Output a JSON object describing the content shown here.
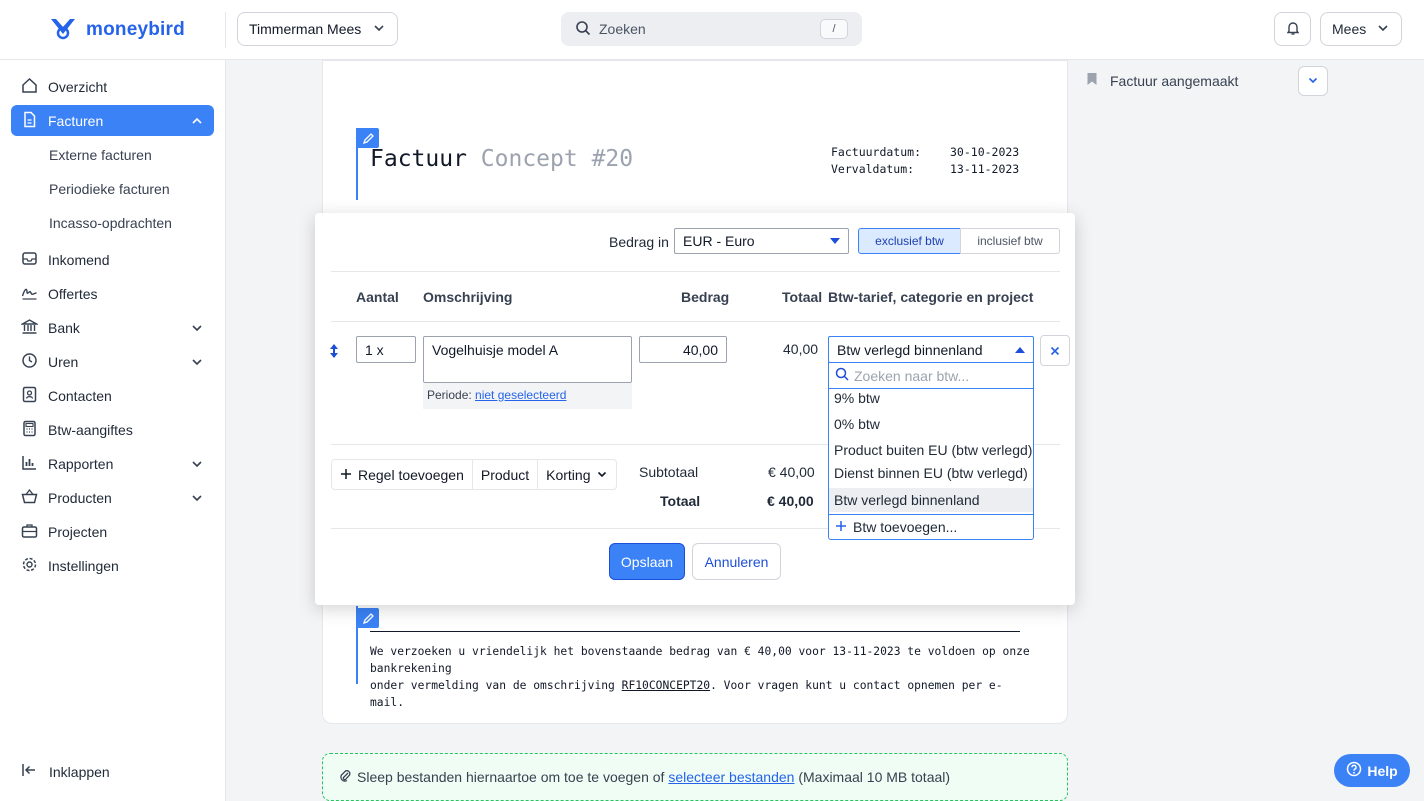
{
  "header": {
    "logo_text": "moneybird",
    "company": "Timmerman Mees",
    "search_placeholder": "Zoeken",
    "search_shortcut": "/",
    "user": "Mees"
  },
  "sidebar": {
    "items": [
      {
        "label": "Overzicht"
      },
      {
        "label": "Facturen"
      },
      {
        "label": "Externe facturen"
      },
      {
        "label": "Periodieke facturen"
      },
      {
        "label": "Incasso-opdrachten"
      },
      {
        "label": "Inkomend"
      },
      {
        "label": "Offertes"
      },
      {
        "label": "Bank"
      },
      {
        "label": "Uren"
      },
      {
        "label": "Contacten"
      },
      {
        "label": "Btw-aangiftes"
      },
      {
        "label": "Rapporten"
      },
      {
        "label": "Producten"
      },
      {
        "label": "Projecten"
      },
      {
        "label": "Instellingen"
      }
    ],
    "collapse_label": "Inklappen"
  },
  "invoice": {
    "title": "Factuur",
    "concept": "Concept #20",
    "date_label": "Factuurdatum:",
    "date_value": "30-10-2023",
    "due_label": "Vervaldatum:",
    "due_value": "13-11-2023",
    "footer_1": "We verzoeken u vriendelijk het bovenstaande bedrag van € 40,00 voor 13-11-2023 te voldoen op onze bankrekening",
    "footer_2a": "onder vermelding van de omschrijving ",
    "footer_2_ref": "RF10CONCEPT20",
    "footer_2b": ". Voor vragen kunt u contact opnemen per e-mail."
  },
  "editor": {
    "amount_in_label": "Bedrag in",
    "currency": "EUR - Euro",
    "excl_label": "exclusief btw",
    "incl_label": "inclusief btw",
    "col_qty": "Aantal",
    "col_desc": "Omschrijving",
    "col_amount": "Bedrag",
    "col_total": "Totaal",
    "col_vat": "Btw-tarief, categorie en project",
    "row": {
      "qty": "1 x",
      "description": "Vogelhuisje model A",
      "amount": "40,00",
      "total": "40,00",
      "vat": "Btw verlegd binnenland",
      "period_label": "Periode:",
      "period_link": "niet geselecteerd"
    },
    "add_line": "Regel toevoegen",
    "product": "Product",
    "discount": "Korting",
    "subtotal_label": "Subtotaal",
    "subtotal_value": "€ 40,00",
    "total_label": "Totaal",
    "total_value": "€ 40,00",
    "save": "Opslaan",
    "cancel": "Annuleren"
  },
  "vat_dropdown": {
    "search_placeholder": "Zoeken naar btw...",
    "options": [
      "9% btw",
      "0% btw",
      "Product buiten EU (btw verlegd)",
      "Dienst binnen EU (btw verlegd)",
      "Btw verlegd binnenland"
    ],
    "selected": "Btw verlegd binnenland",
    "add_label": "Btw toevoegen..."
  },
  "attachments": {
    "text_before": "Sleep bestanden hiernaartoe om toe te voegen of ",
    "link": "selecteer bestanden",
    "text_after": " (Maximaal 10 MB totaal)"
  },
  "activity": {
    "label": "Factuur aangemaakt"
  },
  "help_label": "Help",
  "colors": {
    "accent": "#3b82f6",
    "brand": "#2563eb",
    "attachment_border": "#22c55e"
  }
}
